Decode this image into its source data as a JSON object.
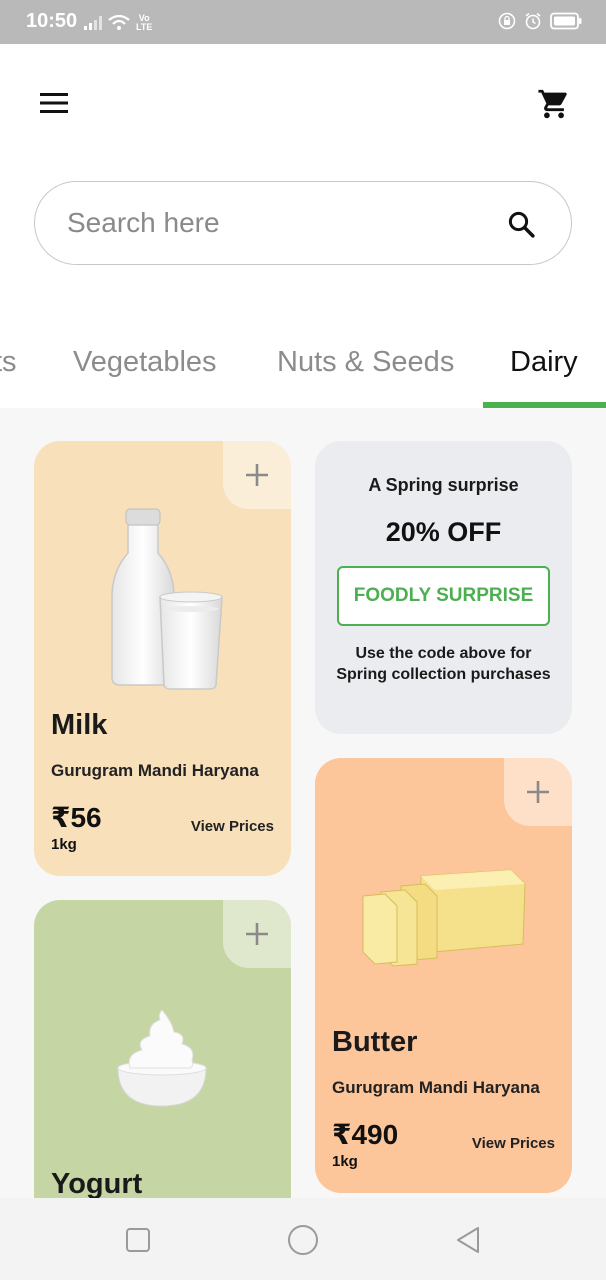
{
  "status_bar": {
    "time": "10:50",
    "volte_top": "Vo",
    "volte_bottom": "LTE"
  },
  "header": {
    "menu_icon": "hamburger-menu-icon",
    "cart_icon": "shopping-cart-icon"
  },
  "search": {
    "placeholder": "Search here",
    "value": "",
    "icon": "search-icon"
  },
  "tabs": [
    {
      "label": "ts",
      "active": false
    },
    {
      "label": "Vegetables",
      "active": false
    },
    {
      "label": "Nuts & Seeds",
      "active": false
    },
    {
      "label": "Dairy",
      "active": true
    }
  ],
  "colors": {
    "accent": "#4caf50",
    "milk_card": "#f8e0bb",
    "butter_card": "#fdc59a",
    "yogurt_card": "#c5d5a4",
    "promo_card": "#ebecf0"
  },
  "promo": {
    "title": "A Spring surprise",
    "discount": "20% OFF",
    "code": "FOODLY SURPRISE",
    "desc_line1": "Use the code above for",
    "desc_line2": "Spring collection purchases"
  },
  "products": {
    "milk": {
      "name": "Milk",
      "origin": "Gurugram Mandi Haryana",
      "price": "₹56",
      "unit": "1kg",
      "link": "View Prices"
    },
    "butter": {
      "name": "Butter",
      "origin": "Gurugram Mandi Haryana",
      "price": "₹490",
      "unit": "1kg",
      "link": "View Prices"
    },
    "yogurt": {
      "name": "Yogurt"
    }
  }
}
